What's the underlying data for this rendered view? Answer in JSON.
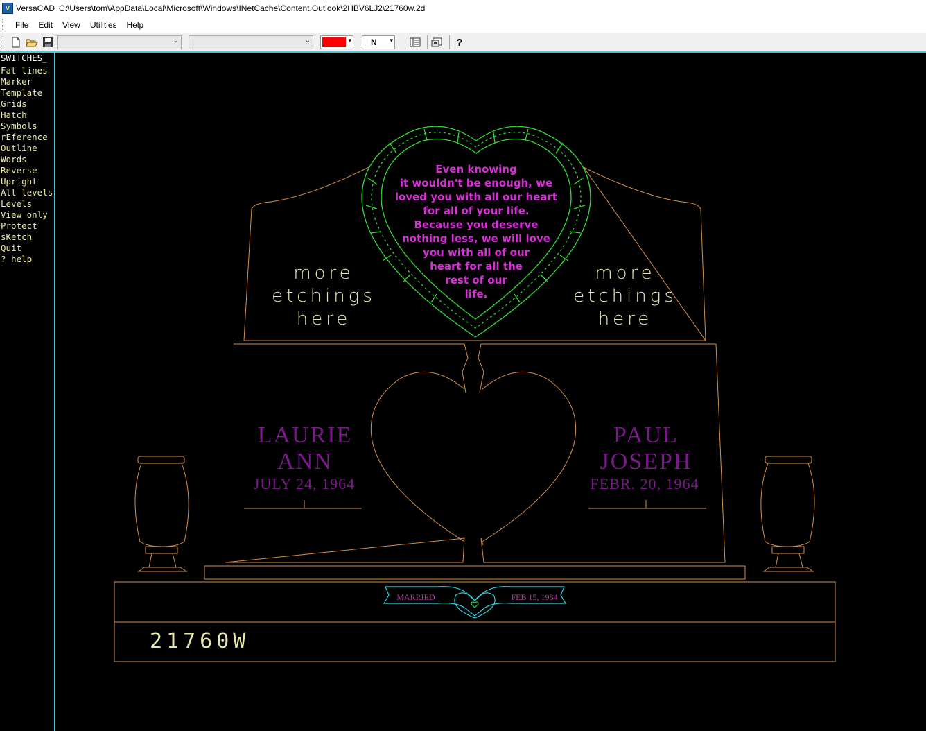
{
  "window": {
    "app_name": "VersaCAD",
    "file_path": "C:\\Users\\tom\\AppData\\Local\\Microsoft\\Windows\\INetCache\\Content.Outlook\\2HBV6LJ2\\21760w.2d",
    "icon": "versacad-app-icon"
  },
  "menu": [
    "File",
    "Edit",
    "View",
    "Utilities",
    "Help"
  ],
  "toolbar": {
    "icons": [
      "new-file-icon",
      "open-folder-icon",
      "save-icon",
      "layout-icon",
      "properties-icon",
      "help-icon"
    ],
    "combo1_value": "",
    "combo2_value": "",
    "color": "#ff0000",
    "line_style": "N"
  },
  "sidebar": {
    "heading": "SWITCHES",
    "items": [
      "Fat lines",
      "Marker",
      "Template",
      "Grids",
      "Hatch",
      "Symbols",
      "rEference",
      "Outline",
      "Words",
      "Reverse",
      "Upright",
      "All levels",
      "Levels",
      "View only",
      "Protect",
      "sKetch",
      "Quit",
      "? help"
    ]
  },
  "drawing": {
    "verse": [
      "Even knowing",
      "it wouldn't be enough, we",
      "loved you with all our heart",
      "for all of your life.",
      "Because you deserve",
      "nothing less, we will love",
      "you with all of our",
      "heart for all the",
      "rest of our",
      "life."
    ],
    "left_etching": [
      "more",
      "etchings",
      "here"
    ],
    "right_etching": [
      "more",
      "etchings",
      "here"
    ],
    "left_name": [
      "LAURIE",
      "ANN"
    ],
    "left_date": "JULY 24, 1964",
    "right_name": [
      "PAUL",
      "JOSEPH"
    ],
    "right_date": "FEBR. 20, 1964",
    "ribbon_left": "MARRIED",
    "ribbon_right": "FEB 15, 1984",
    "part_number": "21760W",
    "colors": {
      "outline": "#d4904a",
      "wreath": "#33dd33",
      "verse": "#d630d6",
      "names": "#7a1a8a",
      "etching_text": "#e6e6b0",
      "ribbon": "#30d0e0",
      "ribbon_text": "#b03aa8"
    }
  }
}
